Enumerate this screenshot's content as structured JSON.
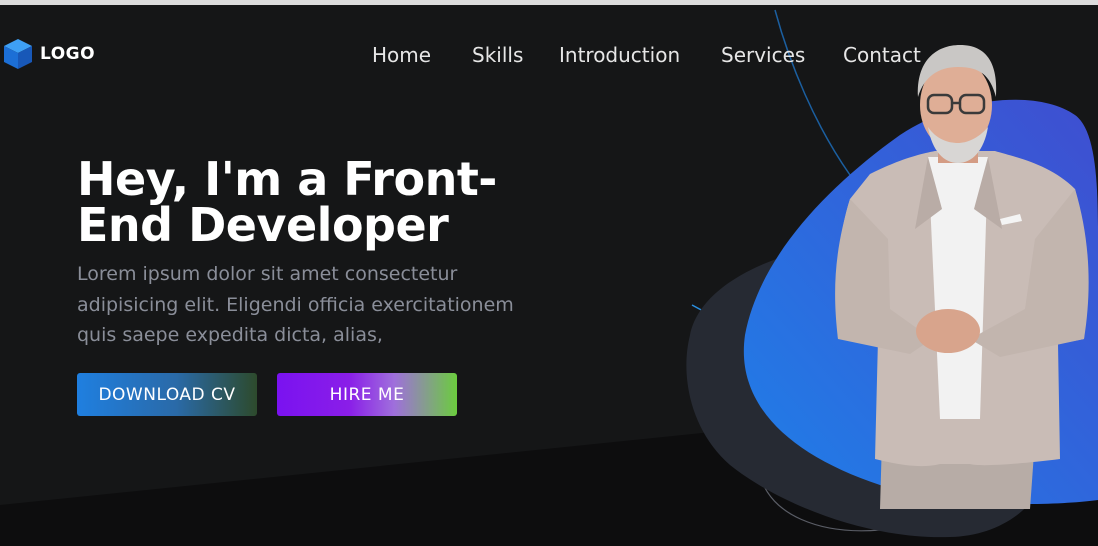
{
  "nav": {
    "logo_text": "LOGO",
    "items": [
      {
        "label": "Home"
      },
      {
        "label": "Skills"
      },
      {
        "label": "Introduction"
      },
      {
        "label": "Services"
      },
      {
        "label": "Contact"
      }
    ]
  },
  "hero": {
    "title": "Hey, I'm a Front-End Developer",
    "description": "Lorem ipsum dolor sit amet consectetur adipisicing elit. Eligendi officia exercitationem quis saepe expedita dicta, alias,",
    "download_label": "DOWNLOAD CV",
    "hire_label": "HIRE ME"
  },
  "colors": {
    "background": "#151617",
    "accent_blue": "#2878e0",
    "accent_purple": "#7a12f0",
    "accent_green": "#6bcc3e"
  }
}
